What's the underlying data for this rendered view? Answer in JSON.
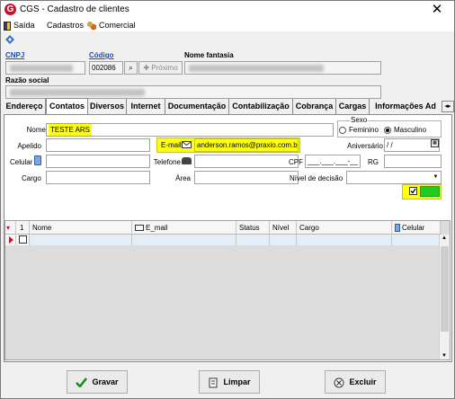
{
  "window": {
    "title": "CGS - Cadastro de clientes",
    "close_glyph": "✕",
    "logo_letter": "G"
  },
  "menu": {
    "items": [
      "Saída",
      "Cadastros",
      "Comercial"
    ]
  },
  "header": {
    "cnpj_label": "CNPJ",
    "codigo_label": "Código",
    "codigo_value": "002086",
    "proximo_label": "Próximo",
    "nome_fantasia_label": "Nome fantasia",
    "razao_social_label": "Razão social"
  },
  "tabs": [
    "Endereço",
    "Contatos",
    "Diversos",
    "Internet",
    "Documentação",
    "Contabilização",
    "Cobrança",
    "Cargas",
    "Informações Ad"
  ],
  "active_tab": "Contatos",
  "form": {
    "nome_label": "Nome",
    "nome_value": "TESTE ARS",
    "sexo_label": "Sexo",
    "feminino_label": "Feminino",
    "masculino_label": "Masculino",
    "apelido_label": "Apelido",
    "email_label": "E-mail",
    "email_value": "anderson.ramos@praxio.com.br",
    "aniversario_label": "Aniversário",
    "aniversario_value": "/ /",
    "celular_label": "Celular",
    "telefone_label": "Telefone",
    "cpf_label": "CPF",
    "cpf_value": "___.___.___-__",
    "rg_label": "RG",
    "cargo_label": "Cargo",
    "area_label": "Área",
    "nivel_decisao_label": "Nível de decisão"
  },
  "grid": {
    "columns": [
      "Nome",
      "E_mail",
      "Status",
      "Nível",
      "Cargo",
      "Celular"
    ],
    "row_num_header": "1"
  },
  "buttons": {
    "gravar": "Gravar",
    "limpar": "Limpar",
    "excluir": "Excluir"
  },
  "colors": {
    "highlight": "#ffff14",
    "accent_link": "#1f4ea5",
    "green_box": "#22cc22",
    "logo": "#c8102e"
  }
}
